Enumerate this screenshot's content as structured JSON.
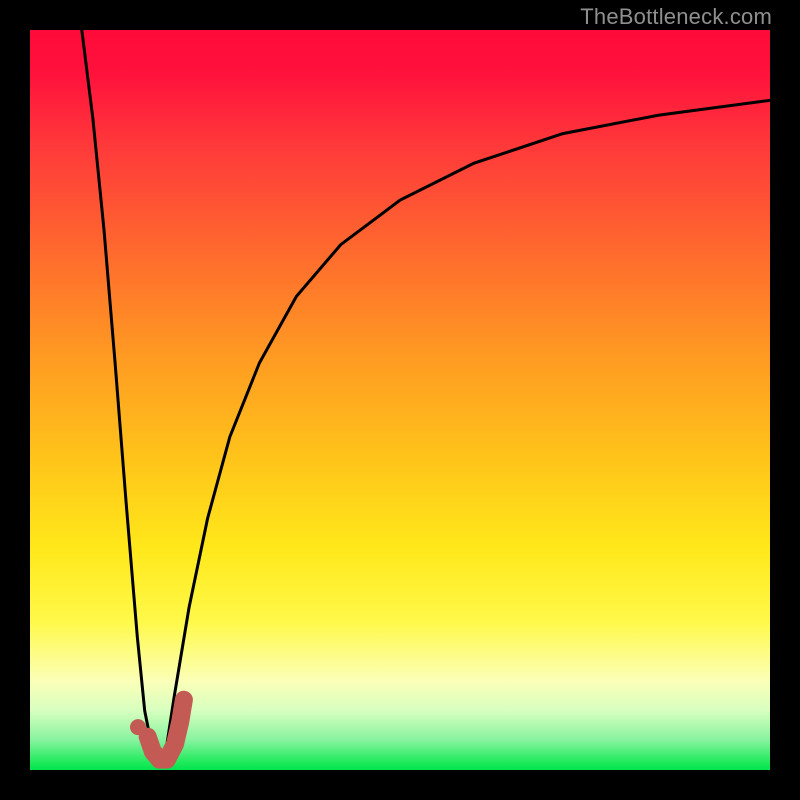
{
  "watermark": {
    "text": "TheBottleneck.com"
  },
  "colors": {
    "frame": "#000000",
    "curve_stroke": "#000000",
    "marker_stroke": "#c45a54",
    "marker_dot": "#c45a54",
    "gradient_top": "#ff0a3a",
    "gradient_bottom": "#00e44e"
  },
  "chart_data": {
    "type": "line",
    "title": "",
    "xlabel": "",
    "ylabel": "",
    "xlim": [
      0,
      100
    ],
    "ylim": [
      0,
      100
    ],
    "axes_hidden": true,
    "grid": false,
    "note": "x and y are in percent of the plot area; y is read as distance from top (0=top, 100=bottom). Values estimated from pixels.",
    "series": [
      {
        "name": "left-branch",
        "x": [
          7.0,
          8.5,
          10.0,
          11.5,
          13.0,
          14.5,
          15.5,
          16.8
        ],
        "y": [
          0.0,
          12.0,
          27.0,
          45.0,
          64.0,
          82.0,
          92.0,
          98.5
        ]
      },
      {
        "name": "right-branch",
        "x": [
          18.2,
          19.5,
          21.5,
          24.0,
          27.0,
          31.0,
          36.0,
          42.0,
          50.0,
          60.0,
          72.0,
          85.0,
          100.0
        ],
        "y": [
          98.5,
          90.0,
          78.0,
          66.0,
          55.0,
          45.0,
          36.0,
          29.0,
          23.0,
          18.0,
          14.0,
          11.5,
          9.5
        ]
      },
      {
        "name": "marker-hook",
        "x": [
          15.9,
          16.6,
          17.5,
          18.5,
          19.6,
          20.3,
          20.8
        ],
        "y": [
          95.5,
          97.5,
          98.6,
          98.6,
          96.5,
          93.5,
          90.5
        ]
      }
    ],
    "marker_dot": {
      "x": 14.6,
      "y": 94.2
    },
    "minimum_x_pct": 17.5
  }
}
